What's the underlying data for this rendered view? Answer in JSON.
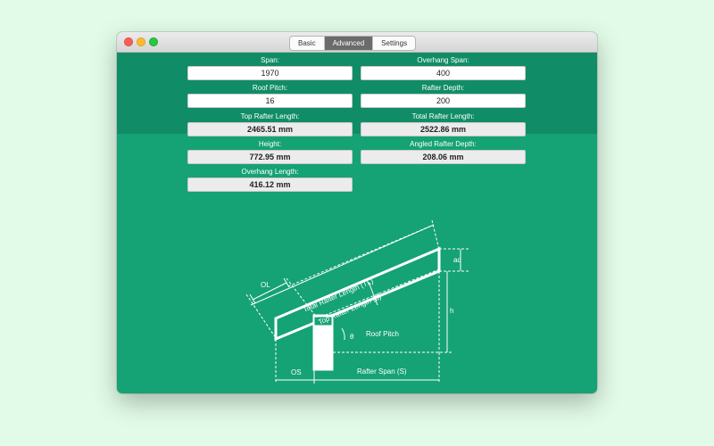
{
  "tabs": {
    "basic": "Basic",
    "advanced": "Advanced",
    "settings": "Settings"
  },
  "inputs": {
    "span": {
      "label": "Span:",
      "value": "1970"
    },
    "overhang_span": {
      "label": "Overhang Span:",
      "value": "400"
    },
    "roof_pitch": {
      "label": "Roof Pitch:",
      "value": "16"
    },
    "rafter_depth": {
      "label": "Rafter Depth:",
      "value": "200"
    }
  },
  "outputs": {
    "top_rafter_length": {
      "label": "Top Rafter Length:",
      "value": "2465.51 mm"
    },
    "total_rafter_length": {
      "label": "Total Rafter Length:",
      "value": "2522.86 mm"
    },
    "height": {
      "label": "Height:",
      "value": "772.95 mm"
    },
    "angled_rafter_depth": {
      "label": "Angled Rafter Depth:",
      "value": "208.06 mm"
    },
    "overhang_length": {
      "label": "Overhang Length:",
      "value": "416.12 mm"
    }
  },
  "diagram": {
    "total_rafter_length": "Total Rafter Length (TL)",
    "top_rafter_length": "Top Rafter Length (L)",
    "ol": "OL",
    "rd": "rd",
    "ad": "ad",
    "h": "h",
    "theta": "θ",
    "roof_pitch": "Roof Pitch",
    "os": "OS",
    "rafter_span": "Rafter Span (S)"
  },
  "colors": {
    "window_bg": "#15a275",
    "top_panel_bg": "#108d66",
    "page_bg": "#e2fbe8",
    "active_tab": "#6b6b6b"
  }
}
